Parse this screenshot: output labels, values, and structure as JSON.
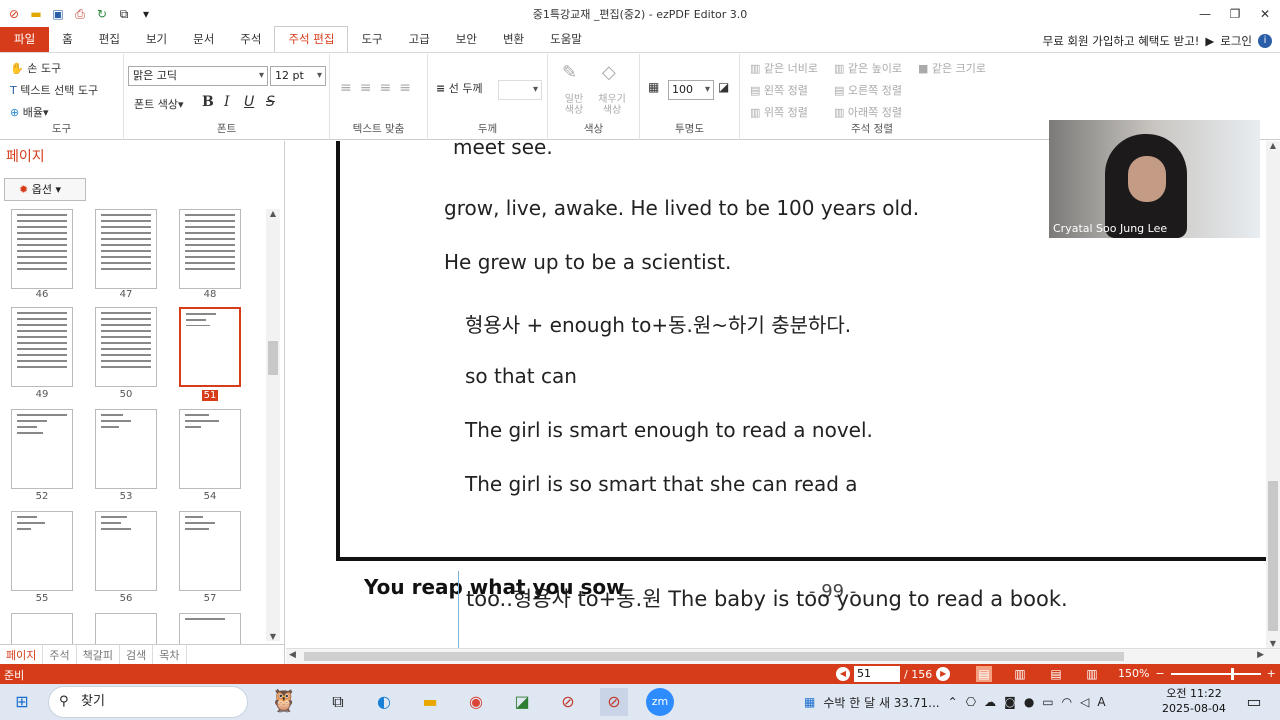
{
  "app": {
    "title": "중1특강교재 _편집(중2) - ezPDF Editor 3.0"
  },
  "menu": {
    "tabs": [
      "파일",
      "홈",
      "편집",
      "보기",
      "문서",
      "주석",
      "주석 편집",
      "도구",
      "고급",
      "보안",
      "변환",
      "도움말"
    ],
    "promo": "무료 회원 가입하고 혜택도 받고!",
    "login": "로그인"
  },
  "ribbon": {
    "tools": {
      "hand": "손 도구",
      "text_select": "텍스트 선택 도구",
      "arrange": "배율",
      "label": "도구"
    },
    "font": {
      "family": "맑은 고딕",
      "size": "12 pt",
      "color": "폰트 색상",
      "bold": "B",
      "italic": "I",
      "underline": "U",
      "strike": "S",
      "label": "폰트"
    },
    "align": {
      "label": "텍스트 맞춤"
    },
    "thickness": {
      "line": "선 두께",
      "label": "두께"
    },
    "color": {
      "general": "일반 색상",
      "fill": "채우기 색상",
      "label": "색상"
    },
    "opacity": {
      "value": "100",
      "label": "투명도"
    },
    "arrange_notes": {
      "same_width": "같은 너비로",
      "same_height": "같은 높이로",
      "same_size": "같은 크기로",
      "left": "왼쪽 정렬",
      "right": "오른쪽 정렬",
      "top": "위쪽 정렬",
      "bottom": "아래쪽 정렬",
      "label": "주석 정렬"
    }
  },
  "sidebar": {
    "title": "페이지",
    "options": "옵션",
    "thumbnails": [
      "46",
      "47",
      "48",
      "49",
      "50",
      "51",
      "52",
      "53",
      "54",
      "55",
      "56",
      "57"
    ],
    "selected": "51",
    "tabs": [
      "페이지",
      "주석",
      "책갈피",
      "검색",
      "목차"
    ]
  },
  "document": {
    "lines": [
      "meet see.",
      "grow, live, awake.   He lived to be 100 years old.",
      "He grew up to be a scientist.",
      "형용사 + enough to+동.원~하기  충분하다.",
      "so that can",
      "The girl is smart enough to read a novel.",
      "The girl is so smart that she can read a"
    ],
    "motto": "You  reap  what you  sow",
    "page_number": "- 99 -",
    "overlay": "too..형용사 to+동.원 The baby is too young to read a book."
  },
  "video": {
    "name": "Cryatal Soo Jung Lee"
  },
  "status": {
    "ready": "준비",
    "current_page": "51",
    "total_pages": "/ 156",
    "zoom": "150%"
  },
  "taskbar": {
    "search": "찾기",
    "notification": "수박 한 달 새 33.71...",
    "ime": "A",
    "time": "오전 11:22",
    "date": "2025-08-04"
  }
}
